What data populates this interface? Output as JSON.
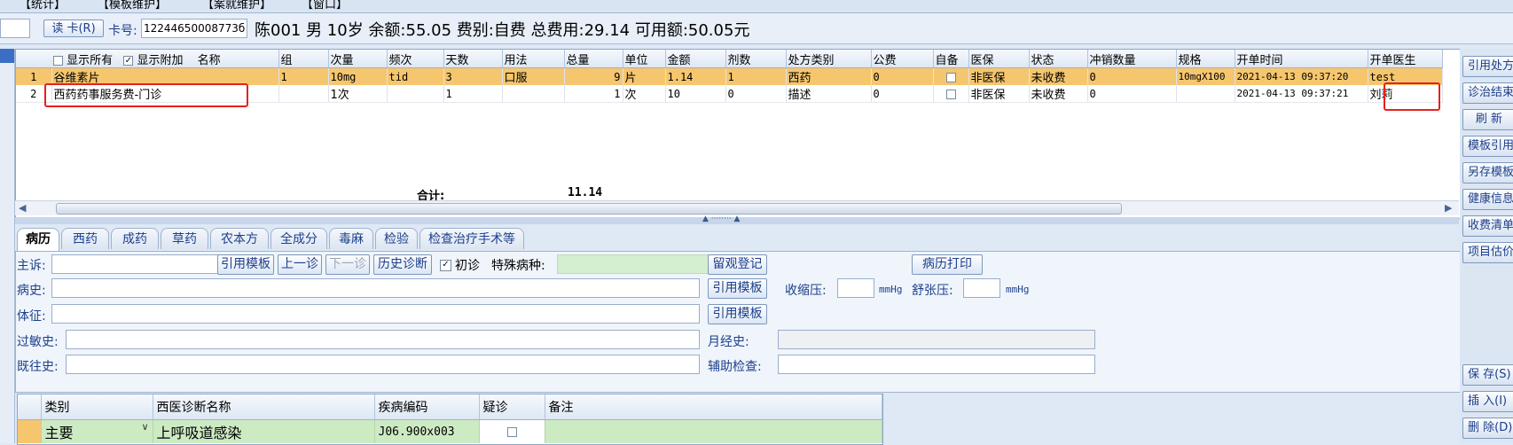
{
  "menu": [
    "【统计】",
    "【模板维护】",
    "【案就维护】",
    "【窗口】"
  ],
  "patient": {
    "read_card_label": "读 卡(R)",
    "card_label": "卡号:",
    "card_number": "12244650008773б",
    "info": "陈001 男 10岁 余额:55.05 费别:自费 总费用:29.14 可用额:50.05元"
  },
  "grid": {
    "show_all_label": "显示所有",
    "show_extra_label": "显示附加",
    "columns": [
      "名称",
      "组",
      "次量",
      "频次",
      "天数",
      "用法",
      "总量",
      "单位",
      "金额",
      "剂数",
      "处方类别",
      "公费",
      "自备",
      "医保",
      "状态",
      "冲销数量",
      "规格",
      "开单时间",
      "开单医生"
    ],
    "rows": [
      {
        "no": "1",
        "name": "谷维素片",
        "group": "1",
        "dose": "10mg",
        "freq": "tid",
        "days": "3",
        "usage": "口服",
        "total": "9",
        "unit": "片",
        "amount": "1.14",
        "doses": "1",
        "rx_type": "西药",
        "public": "0",
        "insurance": "非医保",
        "status": "未收费",
        "writeoff": "0",
        "spec": "10mgX100",
        "time": "2021-04-13 09:37:20",
        "doctor": "test"
      },
      {
        "no": "2",
        "name": "西药药事服务费-门诊",
        "group": "",
        "dose": "1次",
        "freq": "",
        "days": "1",
        "usage": "",
        "total": "1",
        "unit": "次",
        "amount": "10",
        "doses": "0",
        "rx_type": "描述",
        "public": "0",
        "insurance": "非医保",
        "status": "未收费",
        "writeoff": "0",
        "spec": "",
        "time": "2021-04-13 09:37:21",
        "doctor": "刘莉"
      }
    ],
    "sum_label": "合计:",
    "sum_value": "11.14"
  },
  "right_buttons": [
    "引用处方",
    "诊治结束",
    "刷 新",
    "模板引用",
    "另存模板",
    "健康信息",
    "收费清单",
    "项目估价",
    "保 存(S)",
    "插 入(I)",
    "删 除(D)"
  ],
  "tabs": [
    "病历",
    "西药",
    "成药",
    "草药",
    "农本方",
    "全成分",
    "毒麻",
    "检验",
    "检查治疗手术等"
  ],
  "form": {
    "complaint_label": "主诉:",
    "cite_template": "引用模板",
    "prev": "上一诊",
    "next": "下一诊",
    "history_diag": "历史诊断",
    "first_visit_label": "初诊",
    "special_disease_label": "特殊病种:",
    "observe_register": "留观登记",
    "record_print": "病历打印",
    "history_label": "病史:",
    "systolic_label": "收缩压:",
    "diastolic_label": "舒张压:",
    "unit_mmhg": "mmHg",
    "sign_label": "体征:",
    "allergy_label": "过敏史:",
    "menstrual_label": "月经史:",
    "past_label": "既往史:",
    "aux_exam_label": "辅助检查:"
  },
  "diagnosis": {
    "columns": [
      "类别",
      "西医诊断名称",
      "疾病编码",
      "疑诊",
      "备注"
    ],
    "rows": [
      {
        "type": "主要",
        "name": "上呼吸道感染",
        "code": "J06.900x003",
        "suspect": "",
        "note": ""
      }
    ]
  },
  "colors": {
    "selected_row": "#f6c66e",
    "highlight": "#e8201c",
    "accent": "#1c3f8c"
  }
}
